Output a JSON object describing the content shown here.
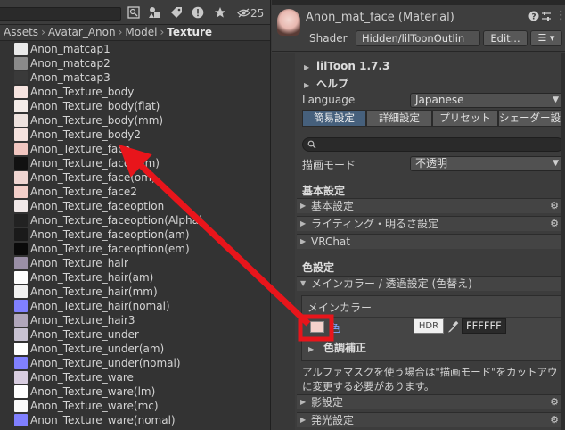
{
  "project_panel": {
    "toolbar": {
      "eye_count": "25"
    },
    "breadcrumb": [
      "Assets",
      "Avatar_Anon",
      "Model",
      "Texture"
    ],
    "assets": [
      {
        "name": "Anon_matcap1",
        "thumb": "#e9e9e9"
      },
      {
        "name": "Anon_matcap2",
        "thumb": "#8a8a8a"
      },
      {
        "name": "Anon_matcap3",
        "thumb": "#3a3a3a"
      },
      {
        "name": "Anon_Texture_body",
        "thumb": "#f6e4e0"
      },
      {
        "name": "Anon_Texture_body(flat)",
        "thumb": "#f4ece8"
      },
      {
        "name": "Anon_Texture_body(mm)",
        "thumb": "#eee2de"
      },
      {
        "name": "Anon_Texture_body2",
        "thumb": "#f5e2de"
      },
      {
        "name": "Anon_Texture_face",
        "thumb": "#f1c6c0"
      },
      {
        "name": "Anon_Texture_face(mm)",
        "thumb": "#111111"
      },
      {
        "name": "Anon_Texture_face(om)",
        "thumb": "#f0d6d2"
      },
      {
        "name": "Anon_Texture_face2",
        "thumb": "#f3cfc9"
      },
      {
        "name": "Anon_Texture_faceoption",
        "thumb": "#f0e8e8"
      },
      {
        "name": "Anon_Texture_faceoption(Alpha)",
        "thumb": "#222222"
      },
      {
        "name": "Anon_Texture_faceoption(am)",
        "thumb": "#1a1a1a"
      },
      {
        "name": "Anon_Texture_faceoption(em)",
        "thumb": "#0a0a0a"
      },
      {
        "name": "Anon_Texture_hair",
        "thumb": "#9a8fa6"
      },
      {
        "name": "Anon_Texture_hair(am)",
        "thumb": "#ffffff"
      },
      {
        "name": "Anon_Texture_hair(mm)",
        "thumb": "#f2f2f2"
      },
      {
        "name": "Anon_Texture_hair(nomal)",
        "thumb": "#8080ff"
      },
      {
        "name": "Anon_Texture_hair3",
        "thumb": "#b0a6bb"
      },
      {
        "name": "Anon_Texture_under",
        "thumb": "#c8c2d2"
      },
      {
        "name": "Anon_Texture_under(am)",
        "thumb": "#ffffff"
      },
      {
        "name": "Anon_Texture_under(nomal)",
        "thumb": "#8080ff"
      },
      {
        "name": "Anon_Texture_ware",
        "thumb": "#d8cde0"
      },
      {
        "name": "Anon_Texture_ware(lm)",
        "thumb": "#ffffff"
      },
      {
        "name": "Anon_Texture_ware(mc)",
        "thumb": "#fafafa"
      },
      {
        "name": "Anon_Texture_ware(nomal)",
        "thumb": "#8080ff"
      }
    ]
  },
  "inspector": {
    "title": "Anon_mat_face (Material)",
    "shader_label": "Shader",
    "shader_value": "Hidden/lilToonOutlin",
    "edit_button": "Edit...",
    "version": "lilToon 1.7.3",
    "help": "ヘルプ",
    "language_label": "Language",
    "language_value": "Japanese",
    "mode_tabs": [
      "簡易設定",
      "詳細設定",
      "プリセット",
      "シェーダー設定"
    ],
    "render_mode_label": "描画モード",
    "render_mode_value": "不透明",
    "basic_header": "基本設定",
    "basic_folds": [
      "基本設定",
      "ライティング・明るさ設定",
      "VRChat"
    ],
    "color_header": "色設定",
    "maincolor_fold": "メインカラー / 透過設定 (色替え)",
    "maincolor_sub": "メインカラー",
    "color_label": "色",
    "hdr_label": "HDR",
    "color_hex": "FFFFFF",
    "tone_correction": "色調補正",
    "alpha_note_1": "アルファマスクを使う場合は\"描画モード\"をカットアウトか半透明",
    "alpha_note_2": "に変更する必要があります。",
    "lower_folds": [
      "影設定",
      "発光設定"
    ]
  },
  "colors": {
    "annotation_red": "#e8151b",
    "selected_tab": "#46607c"
  }
}
